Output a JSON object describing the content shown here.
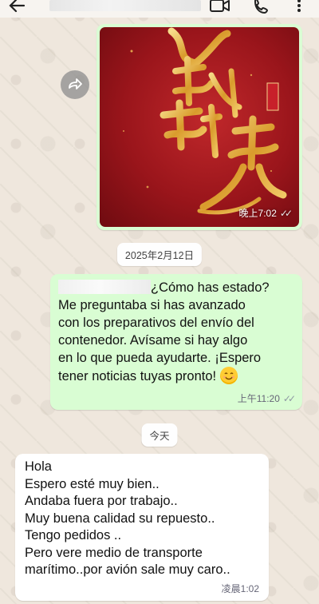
{
  "header": {
    "back_icon": "arrow-left-icon",
    "video_icon": "video-call-icon",
    "call_icon": "phone-icon",
    "more_icon": "more-vertical-icon"
  },
  "image_message": {
    "time": "晚上7:02",
    "status_icon": "double-check-icon"
  },
  "date_separator_1": "2025年2月12日",
  "outgoing_message": {
    "text": "¿Cómo has estado? Me preguntaba si has avanzado con los preparativos del envío del contenedor. Avísame si hay algo en lo que pueda ayudarte. ¡Espero tener noticias tuyas pronto!",
    "lines": [
      "¿Cómo has estado?",
      "Me preguntaba si has avanzado",
      "con los preparativos del envío del",
      "contenedor. Avísame si hay algo",
      "en lo que pueda ayudarte. ¡Espero",
      "tener noticias tuyas pronto!"
    ],
    "emoji": "smiling-face-icon",
    "time": "上午11:20"
  },
  "date_separator_2": "今天",
  "incoming_message": {
    "lines": [
      "Hola",
      "Espero esté muy bien..",
      "Andaba fuera por trabajo..",
      "Muy buena calidad su repuesto..",
      "Tengo pedidos ..",
      "Pero vere medio de transporte",
      "marítimo..por avión sale muy caro.."
    ],
    "time": "凌晨1:02"
  },
  "colors": {
    "outgoing_bubble": "#d9fdd3",
    "incoming_bubble": "#ffffff",
    "wallpaper": "#efe7dd",
    "image_red": "#b51d22",
    "image_gold": "#e8b54a"
  }
}
